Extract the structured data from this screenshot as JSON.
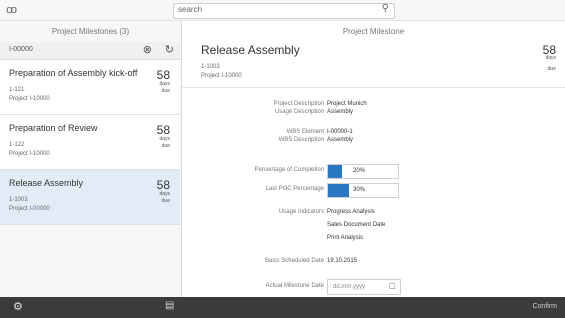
{
  "header": {
    "logo_glyph": "ꝏ",
    "search_value": "search"
  },
  "master": {
    "title": "Project Milestones (3)",
    "filter_text": "I-00000",
    "items": [
      {
        "name": "Preparation of Assembly kick-off",
        "num": "58",
        "unit": "days",
        "unit2": "due",
        "sub1": "1-121",
        "sub2": "Project I-10000"
      },
      {
        "name": "Preparation of Review",
        "num": "58",
        "unit": "days",
        "unit2": "due",
        "sub1": "1-122",
        "sub2": "Project I-10000"
      },
      {
        "name": "Release Assembly",
        "num": "58",
        "unit": "days",
        "unit2": "due",
        "sub1": "1-1003",
        "sub2": "Project I-00000"
      }
    ]
  },
  "detail": {
    "title": "Project Milestone",
    "header": {
      "name": "Release Assembly",
      "num": "58",
      "unit": "days",
      "unit2": "due",
      "sub1": "1-1003",
      "sub2": "Project I-10000"
    },
    "fields": {
      "project_desc_label": "Project Description",
      "project_desc_value": "Project Munich",
      "wbs_desc_label": "Usage Description",
      "wbs_desc_value": "Assembly",
      "wbs_element_label": "WBS Element",
      "wbs_element_value": "I-00000-1",
      "wbs_element_desc_label": "WBS Description",
      "wbs_element_desc_value": "Assembly",
      "pct_completion_label": "Percentage of Completion",
      "pct_completion_text": "20%",
      "pct_completion": 20,
      "pct_pochc_label": "Last POC Percentage",
      "pct_pochc_text": "30%",
      "pct_pochc": 30,
      "usage_indicators_label": "Usage Indicators",
      "usage_1": "Progress Analysis",
      "usage_2": "Sales Document Date",
      "usage_3": "Print Analysis",
      "basic_sched_label": "Basic Scheduled Date",
      "basic_sched_value": "19.10.2015",
      "actual_date_label": "Actual Milestone Date",
      "actual_date_placeholder": "dd.mm.yyyy"
    }
  },
  "footer": {
    "action": "Confirm"
  }
}
